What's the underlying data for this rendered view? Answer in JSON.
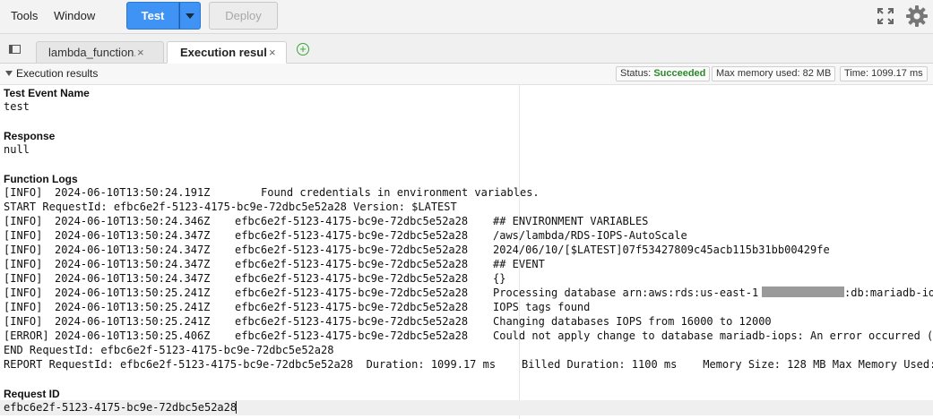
{
  "menu": {
    "tools": "Tools",
    "window": "Window"
  },
  "toolbar": {
    "test_label": "Test",
    "deploy_label": "Deploy"
  },
  "icons": {
    "fullscreen": "fullscreen-icon",
    "settings": "gear-icon",
    "panel": "panel-toggle-icon",
    "add": "add-tab-icon"
  },
  "tabs": [
    {
      "label": "lambda_function.",
      "close": "×"
    },
    {
      "label": "Execution results",
      "close": "×"
    }
  ],
  "results_header": {
    "title": "Execution results",
    "status_label": "Status:",
    "status_value": "Succeeded",
    "memory": "Max memory used: 82 MB",
    "time": "Time: 1099.17 ms"
  },
  "sections": {
    "test_event_name": {
      "title": "Test Event Name",
      "value": "test"
    },
    "response": {
      "title": "Response",
      "value": "null"
    },
    "function_logs": {
      "title": "Function Logs"
    },
    "request_id": {
      "title": "Request ID",
      "value": "efbc6e2f-5123-4175-bc9e-72dbc5e52a28"
    }
  },
  "logs": {
    "first": {
      "level": "[INFO]",
      "ts": "2024-06-10T13:50:24.191Z",
      "msg": "Found credentials in environment variables."
    },
    "start": "START RequestId: efbc6e2f-5123-4175-bc9e-72dbc5e52a28 Version: $LATEST",
    "rows": [
      {
        "level": "[INFO]",
        "ts": "2024-06-10T13:50:24.346Z",
        "rid": "efbc6e2f-5123-4175-bc9e-72dbc5e52a28",
        "msg": "## ENVIRONMENT VARIABLES"
      },
      {
        "level": "[INFO]",
        "ts": "2024-06-10T13:50:24.347Z",
        "rid": "efbc6e2f-5123-4175-bc9e-72dbc5e52a28",
        "msg": "/aws/lambda/RDS-IOPS-AutoScale"
      },
      {
        "level": "[INFO]",
        "ts": "2024-06-10T13:50:24.347Z",
        "rid": "efbc6e2f-5123-4175-bc9e-72dbc5e52a28",
        "msg": "2024/06/10/[$LATEST]07f53427809c45acb115b31bb00429fe"
      },
      {
        "level": "[INFO]",
        "ts": "2024-06-10T13:50:24.347Z",
        "rid": "efbc6e2f-5123-4175-bc9e-72dbc5e52a28",
        "msg": "## EVENT"
      },
      {
        "level": "[INFO]",
        "ts": "2024-06-10T13:50:24.347Z",
        "rid": "efbc6e2f-5123-4175-bc9e-72dbc5e52a28",
        "msg": "{}"
      },
      {
        "level": "[INFO]",
        "ts": "2024-06-10T13:50:25.241Z",
        "rid": "efbc6e2f-5123-4175-bc9e-72dbc5e52a28",
        "msg": "Processing database arn:aws:rds:us-east-1",
        "msg_after": ":db:mariadb-iops"
      },
      {
        "level": "[INFO]",
        "ts": "2024-06-10T13:50:25.241Z",
        "rid": "efbc6e2f-5123-4175-bc9e-72dbc5e52a28",
        "msg": "IOPS tags found"
      },
      {
        "level": "[INFO]",
        "ts": "2024-06-10T13:50:25.241Z",
        "rid": "efbc6e2f-5123-4175-bc9e-72dbc5e52a28",
        "msg": "Changing databases IOPS from 16000 to 12000"
      },
      {
        "level": "[ERROR]",
        "ts": "2024-06-10T13:50:25.406Z",
        "rid": "efbc6e2f-5123-4175-bc9e-72dbc5e52a28",
        "msg": "Could not apply change to database mariadb-iops: An error occurred ("
      }
    ],
    "end": "END RequestId: efbc6e2f-5123-4175-bc9e-72dbc5e52a28",
    "report": "REPORT RequestId: efbc6e2f-5123-4175-bc9e-72dbc5e52a28  Duration: 1099.17 ms    Billed Duration: 1100 ms    Memory Size: 128 MB Max Memory Used:"
  }
}
